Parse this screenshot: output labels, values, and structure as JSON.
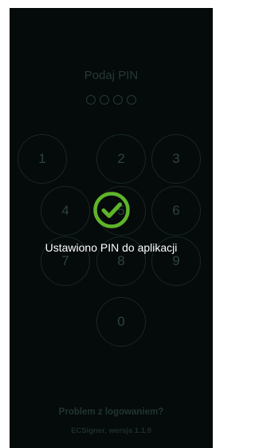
{
  "pin_screen": {
    "title": "Podaj PIN",
    "pin_length": 4,
    "keys": [
      "1",
      "2",
      "3",
      "4",
      "5",
      "6",
      "7",
      "8",
      "9",
      "0"
    ],
    "forgot_link": "Problem z logowaniem?",
    "version": "ECSigner, wersja 1.1.9"
  },
  "toast": {
    "icon": "check-circle-icon",
    "message": "Ustawiono PIN do aplikacji",
    "accent_color": "#5fb42b"
  }
}
